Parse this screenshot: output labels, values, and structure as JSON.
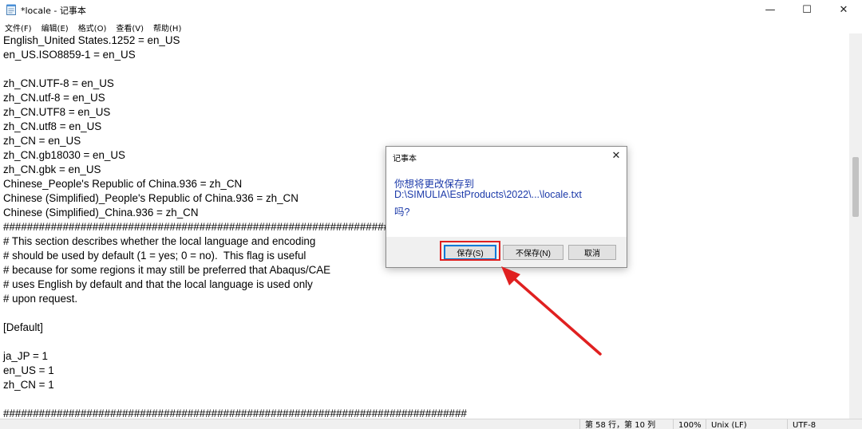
{
  "window": {
    "title": "*locale - 记事本",
    "icon": "notepad-icon",
    "minimize_glyph": "—",
    "maximize_glyph": "☐",
    "close_glyph": "✕"
  },
  "menu": [
    "文件(F)",
    "编辑(E)",
    "格式(O)",
    "查看(V)",
    "帮助(H)"
  ],
  "editor": {
    "lines": [
      "English_United States.1252 = en_US",
      "en_US.ISO8859-1 = en_US",
      "",
      "zh_CN.UTF-8 = en_US",
      "zh_CN.utf-8 = en_US",
      "zh_CN.UTF8 = en_US",
      "zh_CN.utf8 = en_US",
      "zh_CN = en_US",
      "zh_CN.gb18030 = en_US",
      "zh_CN.gbk = en_US",
      "Chinese_People's Republic of China.936 = zh_CN",
      "Chinese (Simplified)_People's Republic of China.936 = zh_CN",
      "Chinese (Simplified)_China.936 = zh_CN",
      "##############################################################################",
      "# This section describes whether the local language and encoding",
      "# should be used by default (1 = yes; 0 = no).  This flag is useful",
      "# because for some regions it may still be preferred that Abaqus/CAE",
      "# uses English by default and that the local language is used only",
      "# upon request.",
      "",
      "[Default]",
      "",
      "ja_JP = 1",
      "en_US = 1",
      "zh_CN = 1",
      "",
      "##############################################################################"
    ]
  },
  "statusbar": {
    "position": "第 58 行，第 10 列",
    "zoom": "100%",
    "line_ending": "Unix (LF)",
    "encoding": "UTF-8"
  },
  "dialog": {
    "title": "记事本",
    "close_glyph": "✕",
    "message_line1": "你想将更改保存到",
    "message_line2": "D:\\SIMULIA\\EstProducts\\2022\\...\\locale.txt",
    "message_line3": "吗?",
    "save_label": "保存(S)",
    "dont_save_label": "不保存(N)",
    "cancel_label": "取消"
  },
  "annotation": {
    "color": "#e02020"
  }
}
